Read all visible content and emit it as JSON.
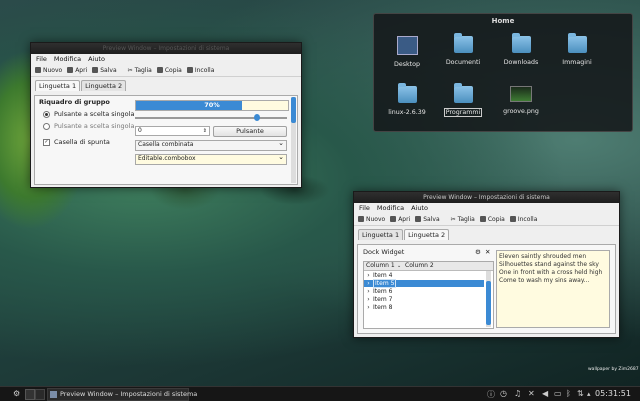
{
  "desktop": {
    "wallpaper_credit": "wallpaper by Zim2687"
  },
  "home": {
    "title": "Home",
    "items": [
      "Desktop",
      "Documenti",
      "Downloads",
      "Immagini",
      "linux-2.6.39",
      "Programmi",
      "groove.png"
    ]
  },
  "win1": {
    "title": "Preview Window – Impostazioni di sistema",
    "menu": [
      "File",
      "Modifica",
      "Aiuto"
    ],
    "toolbar": [
      "Nuovo",
      "Apri",
      "Salva",
      "Taglia",
      "Copia",
      "Incolla"
    ],
    "tabs": [
      "Linguetta 1",
      "Linguetta 2"
    ],
    "group_title": "Riquadro di gruppo",
    "radio1": "Pulsante a scelta singola",
    "radio2": "Pulsante a scelta singola",
    "checkbox": "Casella di spunta",
    "progress_label": "70%",
    "progress": 0.7,
    "slider": 0.8,
    "spin_value": "0",
    "button": "Pulsante",
    "combo": "Casella combinata",
    "combo_editable": "Editable.combobox"
  },
  "win2": {
    "title": "Preview Window – Impostazioni di sistema",
    "menu": [
      "File",
      "Modifica",
      "Aiuto"
    ],
    "toolbar": [
      "Nuovo",
      "Apri",
      "Salva",
      "Taglia",
      "Copia",
      "Incolla"
    ],
    "tabs": [
      "Linguetta 1",
      "Linguetta 2"
    ],
    "dock_title": "Dock Widget",
    "columns": [
      "Column 1",
      "Column 2"
    ],
    "tree_items": [
      "Item 4",
      "Item 5",
      "Item 6",
      "Item 7",
      "Item 8"
    ],
    "selected_index": 1,
    "text_lines": [
      "Eleven saintly shrouded men",
      "Silhouettes stand against the sky",
      "One in front with a cross held high",
      "Come to wash my sins away..."
    ]
  },
  "taskbar": {
    "task_label": "Preview Window – Impostazioni di sistema",
    "clock": "05:31:51"
  }
}
